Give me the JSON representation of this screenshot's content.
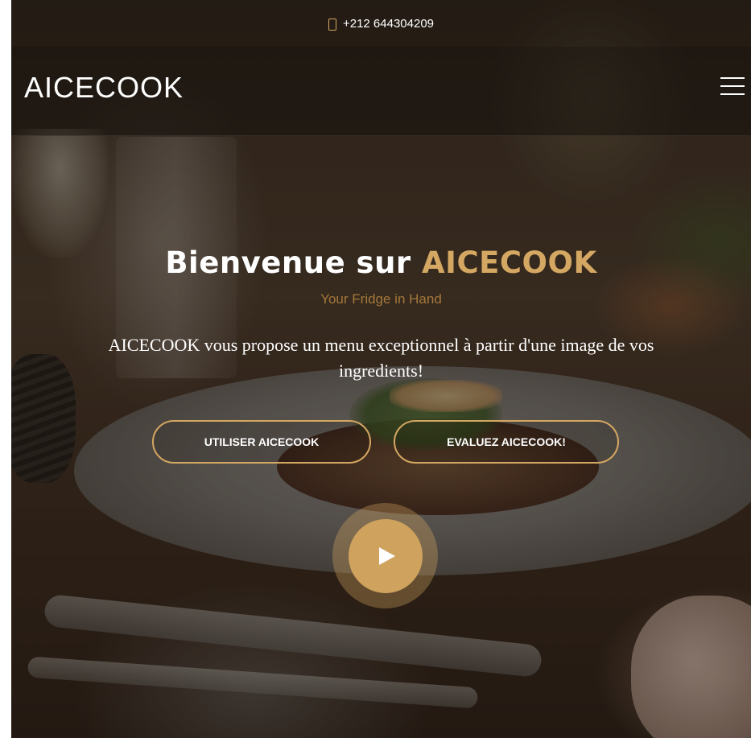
{
  "topbar": {
    "phone_icon": "phone-icon",
    "phone": "+212 644304209"
  },
  "header": {
    "logo": "AICECOOK",
    "menu_icon": "hamburger-menu-icon"
  },
  "hero": {
    "title_prefix": "Bienvenue sur ",
    "title_accent": "AICECOOK",
    "subtitle": "Your Fridge in Hand",
    "description": "AICECOOK vous propose un menu exceptionnel à partir d'une image de vos ingredients!",
    "buttons": {
      "use": "UTILISER AICECOOK",
      "rate": "EVALUEZ AICECOOK!"
    },
    "play_icon": "play-icon"
  },
  "colors": {
    "accent": "#d4a762",
    "play": "#cfa35e",
    "text": "#ffffff"
  }
}
